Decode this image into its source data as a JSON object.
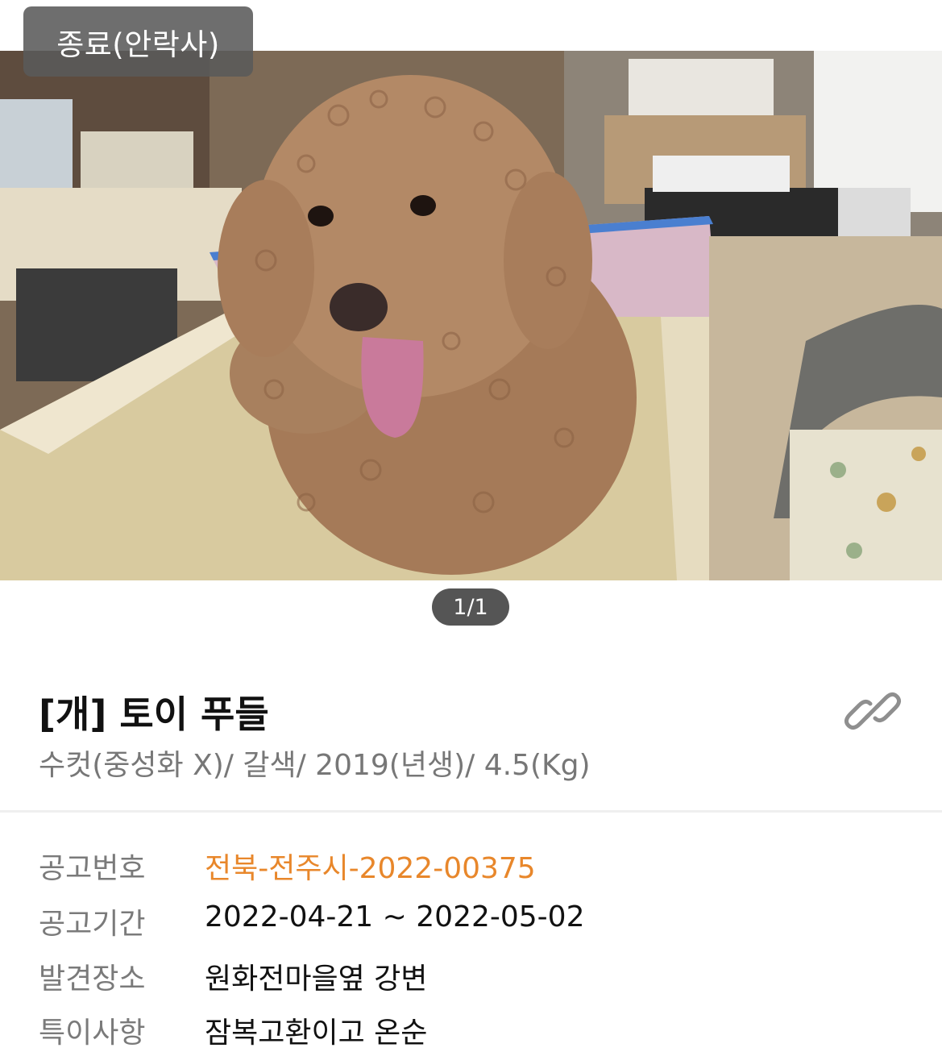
{
  "status": {
    "label": "종료(안락사)"
  },
  "photo": {
    "pager": "1/1"
  },
  "animal": {
    "title": "[개] 토이 푸들",
    "subtitle": "수컷(중성화 X)/ 갈색/ 2019(년생)/ 4.5(Kg)"
  },
  "details": [
    {
      "label": "공고번호",
      "value": "전북-전주시-2022-00375"
    },
    {
      "label": "공고기간",
      "value": "2022-04-21 ~ 2022-05-02"
    },
    {
      "label": "발견장소",
      "value": "원화전마을옆 강변"
    },
    {
      "label": "특이사항",
      "value": "잠복고환이고 온순"
    }
  ],
  "colors": {
    "accent": "#e8872b",
    "badge_bg": "#5a5a5a",
    "pager_bg": "#555555"
  },
  "icons": {
    "share": "link-icon"
  }
}
